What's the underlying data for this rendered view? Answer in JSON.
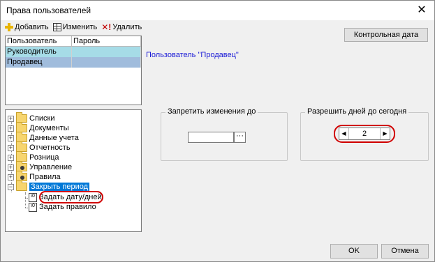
{
  "window": {
    "title": "Права пользователей"
  },
  "toolbar": {
    "add_label": "Добавить",
    "edit_label": "Изменить",
    "delete_label": "Удалить"
  },
  "users_table": {
    "columns": [
      "Пользователь",
      "Пароль"
    ],
    "rows": [
      {
        "user": "Руководитель",
        "password": ""
      },
      {
        "user": "Продавец",
        "password": ""
      }
    ]
  },
  "tree": {
    "items": [
      {
        "label": "Списки",
        "icon": "folder-icon"
      },
      {
        "label": "Документы",
        "icon": "folder-icon"
      },
      {
        "label": "Данные учета",
        "icon": "folder-icon"
      },
      {
        "label": "Отчетность",
        "icon": "folder-icon"
      },
      {
        "label": "Розница",
        "icon": "folder-icon"
      },
      {
        "label": "Управление",
        "icon": "folder-gear-icon"
      },
      {
        "label": "Правила",
        "icon": "folder-gear-icon"
      },
      {
        "label": "Закрыть период",
        "icon": "folder-open-icon"
      }
    ],
    "children": [
      {
        "label": "Задать дату/дней",
        "icon": "doc-icon"
      },
      {
        "label": "Задать правило",
        "icon": "doc-icon"
      }
    ]
  },
  "control_date_button": "Контрольная дата",
  "user_heading": "Пользователь \"Продавец\"",
  "forbid_group": {
    "legend": "Запретить изменения до",
    "date_value": "",
    "ellipsis": "···"
  },
  "allow_group": {
    "legend": "Разрешить дней до сегодня",
    "days_value": "2",
    "left_arrow": "◀",
    "right_arrow": "▶"
  },
  "ok_button": "OK",
  "cancel_button": "Отмена",
  "colors": {
    "accent": "#0078d7",
    "highlight_red": "#d00000",
    "heading_blue": "#1a1ad6"
  }
}
